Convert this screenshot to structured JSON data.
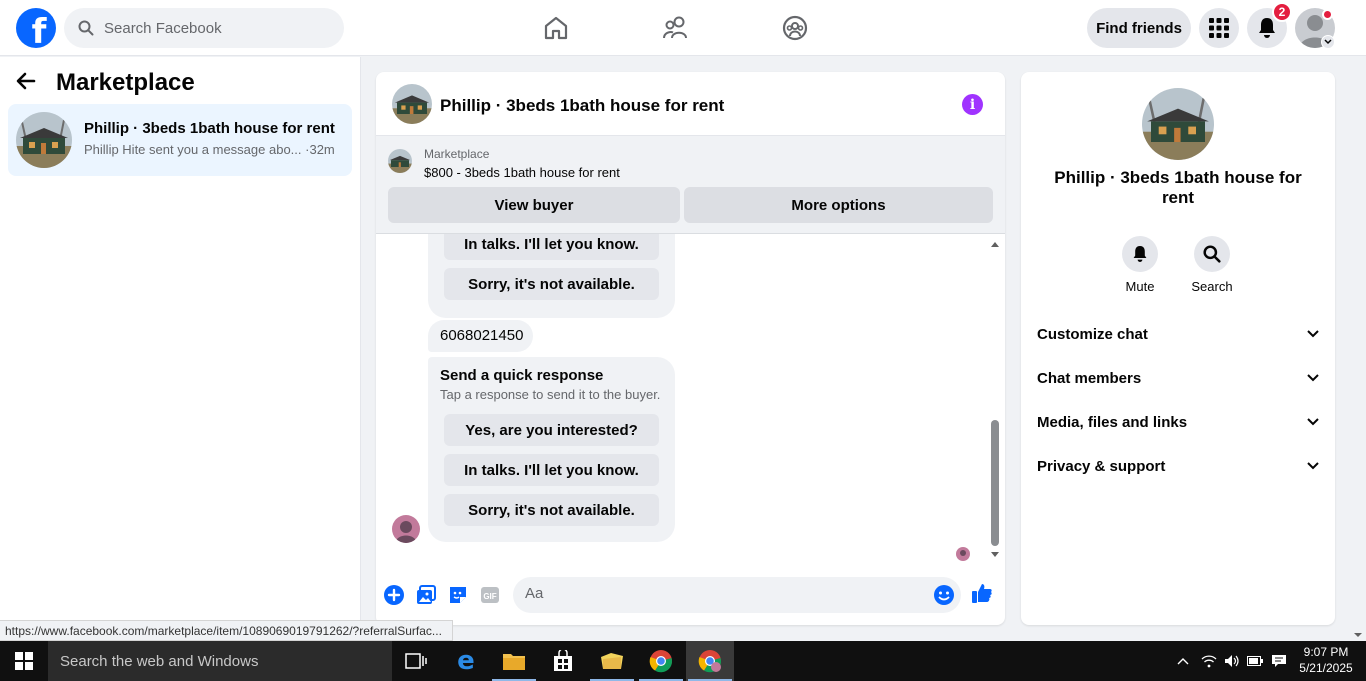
{
  "topbar": {
    "search_placeholder": "Search Facebook",
    "find_friends": "Find friends",
    "notifications_count": "2",
    "logo_letter": "f"
  },
  "sidebar": {
    "title": "Marketplace",
    "conversation": {
      "title": "Phillip · 3beds 1bath house for rent",
      "preview": "Phillip Hite sent you a message abo...",
      "time": "·32m"
    }
  },
  "status_url": "https://www.facebook.com/marketplace/item/1089069019791262/?referralSurfac...",
  "chat": {
    "title": "Phillip · 3beds 1bath house for rent",
    "listing": {
      "label": "Marketplace",
      "price_title": "$800 - 3beds 1bath house for rent",
      "view_buyer": "View buyer",
      "more_options": "More options"
    },
    "top_partial_responses": [
      "In talks. I'll let you know.",
      "Sorry, it's not available."
    ],
    "phone_message": "6068021450",
    "quick_response": {
      "title": "Send a quick response",
      "subtitle": "Tap a response to send it to the buyer.",
      "options": [
        "Yes, are you interested?",
        "In talks. I'll let you know.",
        "Sorry, it's not available."
      ]
    },
    "composer_placeholder": "Aa"
  },
  "details": {
    "title": "Phillip · 3beds 1bath house for rent",
    "actions": [
      "Mute",
      "Search"
    ],
    "sections": [
      "Customize chat",
      "Chat members",
      "Media, files and links",
      "Privacy & support"
    ]
  },
  "taskbar": {
    "search_placeholder": "Search the web and Windows",
    "time": "9:07 PM",
    "date": "5/21/2025"
  },
  "colors": {
    "facebook_blue": "#0866ff",
    "messenger_purple": "#a033ff",
    "badge_red": "#e41e3f",
    "selected_conversation": "#ebf5ff"
  }
}
